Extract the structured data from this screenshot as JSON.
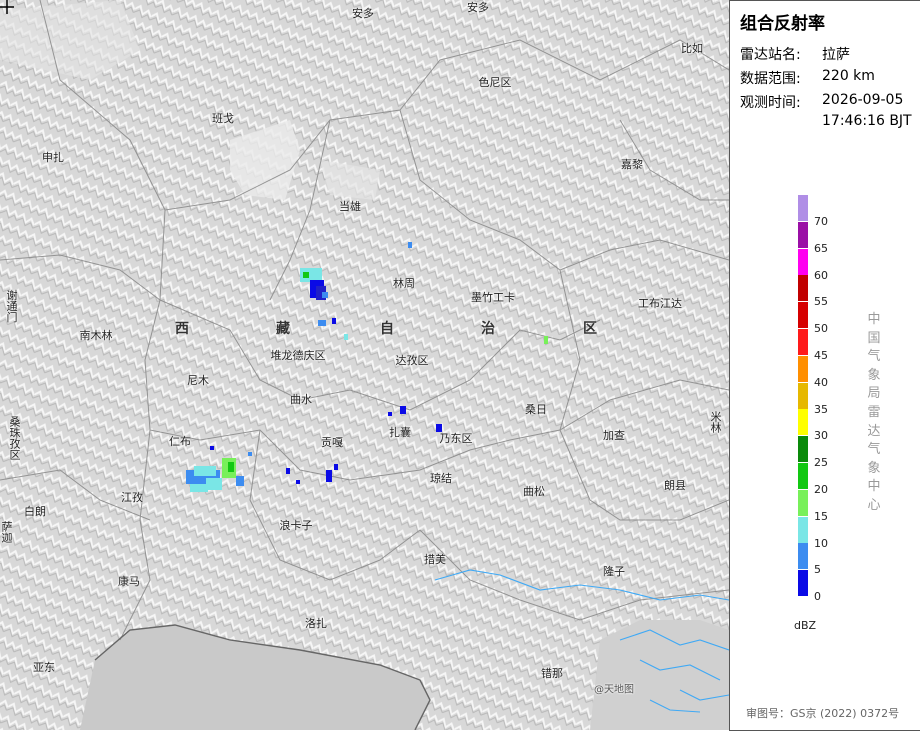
{
  "panel": {
    "title": "组合反射率",
    "station_label": "雷达站名:",
    "station_value": "拉萨",
    "range_label": "数据范围:",
    "range_value": "220 km",
    "time_label": "观测时间:",
    "time_date": "2026-09-05",
    "time_clock": "17:46:16 BJT",
    "source": "中国气象局雷达气象中心",
    "approval": "审图号：GS京 (2022) 0372号",
    "unit": "dBZ"
  },
  "legend": [
    {
      "label": "70",
      "color": "#b08ee6"
    },
    {
      "label": "65",
      "color": "#9a0fa6"
    },
    {
      "label": "60",
      "color": "#ff00f0"
    },
    {
      "label": "55",
      "color": "#c10000"
    },
    {
      "label": "50",
      "color": "#d60000"
    },
    {
      "label": "45",
      "color": "#ff1a1a"
    },
    {
      "label": "40",
      "color": "#ff8f00"
    },
    {
      "label": "35",
      "color": "#e6b800"
    },
    {
      "label": "30",
      "color": "#ffff00"
    },
    {
      "label": "25",
      "color": "#0a8a0a"
    },
    {
      "label": "20",
      "color": "#12c812"
    },
    {
      "label": "15",
      "color": "#78f05a"
    },
    {
      "label": "10",
      "color": "#7ae6e6"
    },
    {
      "label": "5",
      "color": "#3c8cf0"
    },
    {
      "label": "0",
      "color": "#0a0ae6"
    }
  ],
  "map": {
    "places": [
      "安多",
      "安多",
      "比如",
      "色尼区",
      "班戈",
      "申扎",
      "嘉黎",
      "当雄",
      "林周",
      "墨竹工卡",
      "工布江达",
      "南木林",
      "谢通门",
      "达孜区",
      "堆龙德庆区",
      "尼木",
      "曲水",
      "桑日",
      "米林",
      "仁布",
      "贡嘎",
      "扎囊",
      "乃东区",
      "加查",
      "桑珠孜区",
      "琼结",
      "曲松",
      "朗县",
      "江孜",
      "白朗",
      "萨迦",
      "浪卡子",
      "措美",
      "隆子",
      "康马",
      "洛扎",
      "亚东",
      "错那",
      "洛扎"
    ],
    "region_chars": [
      "西",
      "藏",
      "自",
      "治",
      "区"
    ],
    "watermark": "@天地图"
  }
}
